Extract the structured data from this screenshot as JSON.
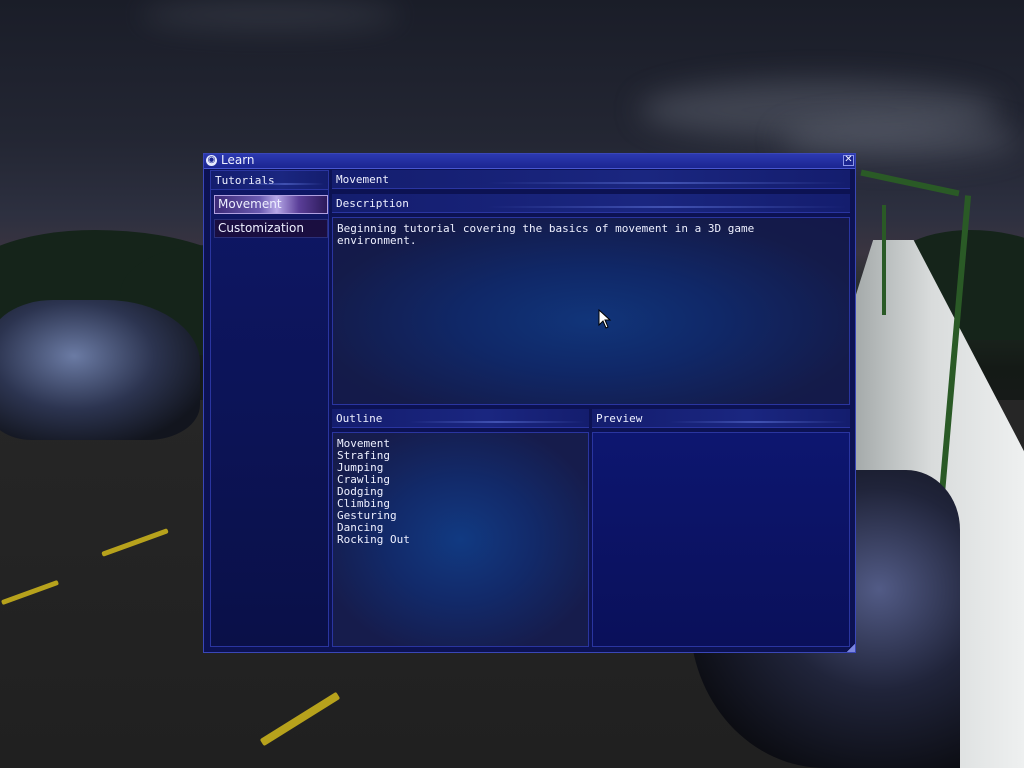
{
  "window": {
    "title": "Learn",
    "close_glyph": "✕",
    "icon": "game-logo-icon"
  },
  "sidebar": {
    "header": "Tutorials",
    "items": [
      {
        "label": "Movement",
        "selected": true
      },
      {
        "label": "Customization",
        "selected": false
      }
    ]
  },
  "main": {
    "title": "Movement",
    "description_header": "Description",
    "description": "Beginning tutorial covering the basics of movement in a 3D game\nenvironment.",
    "outline_header": "Outline",
    "outline": [
      "Movement",
      "Strafing",
      "Jumping",
      "Crawling",
      "Dodging",
      "Climbing",
      "Gesturing",
      "Dancing",
      "Rocking Out"
    ],
    "preview_header": "Preview"
  },
  "colors": {
    "window_bg": "#0c1253",
    "titlebar": "#2c39b0",
    "selected_item": "#6a5ab0",
    "text": "#eef0ff"
  }
}
